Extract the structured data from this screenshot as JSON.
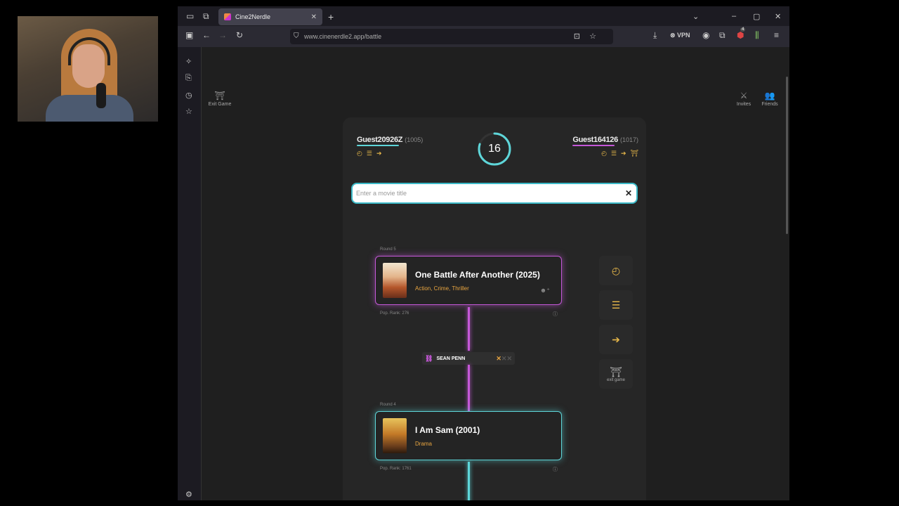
{
  "browser": {
    "tab_title": "Cine2Nerdle",
    "url": "www.cinenerdle2.app/battle",
    "vpn_label": "VPN",
    "extension_badge": "4"
  },
  "header": {
    "exit_game": "Exit Game",
    "invites": "Invites",
    "friends": "Friends"
  },
  "players": [
    {
      "name": "Guest20926Z",
      "rating": "(1005)",
      "color": "#5ed6d9"
    },
    {
      "name": "Guest164126",
      "rating": "(1017)",
      "color": "#c558d8"
    }
  ],
  "timer": {
    "value": "16",
    "fraction_remaining": 0.8
  },
  "search": {
    "placeholder": "Enter a movie title"
  },
  "rounds": [
    {
      "label": "Round 5",
      "title": "One Battle After Another (2025)",
      "genres": "Action, Crime, Thriller",
      "pop_rank": "Pop. Rank:  276",
      "border": "pink"
    },
    {
      "label": "Round 4",
      "title": "I Am Sam (2001)",
      "genres": "Drama",
      "pop_rank": "Pop. Rank:  1761",
      "border": "cyan"
    }
  ],
  "link": {
    "name": "SEAN PENN"
  },
  "side_panel": {
    "exit_label": "exit game"
  },
  "colors": {
    "accent_pink": "#c558d8",
    "accent_cyan": "#5ed6d9",
    "gold": "#e8b84a"
  }
}
